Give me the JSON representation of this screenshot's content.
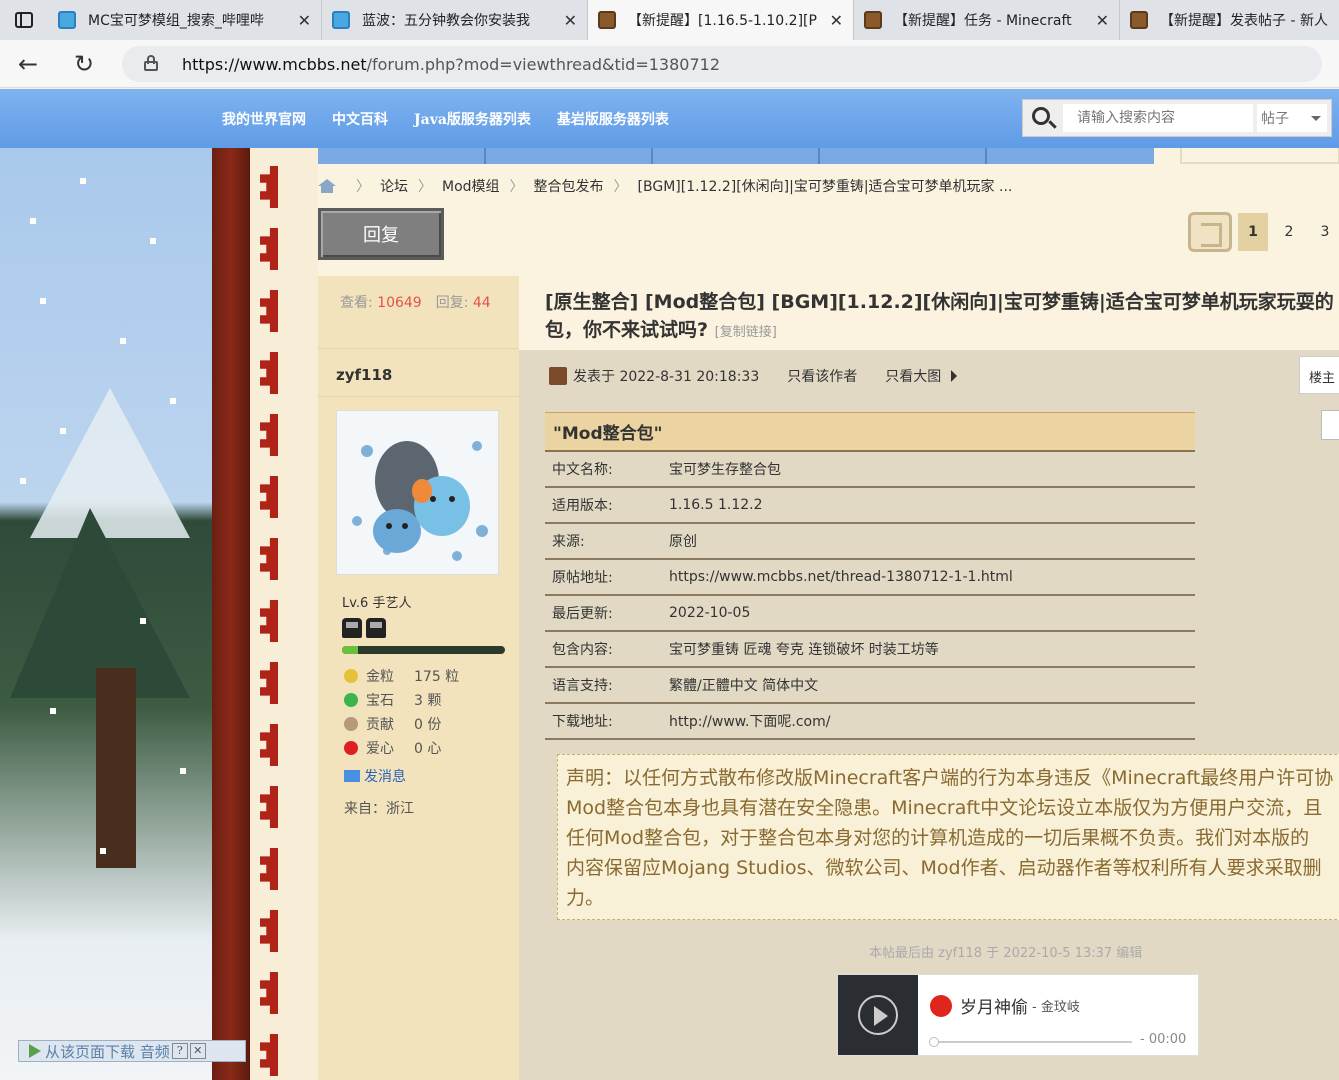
{
  "browser": {
    "tabs": [
      {
        "title": "MC宝可梦模组_搜索_哔哩哔",
        "icon": "bilibili-icon"
      },
      {
        "title": "蓝波：五分钟教会你安装我",
        "icon": "bilibili-icon"
      },
      {
        "title": "【新提醒】[1.16.5-1.10.2][P",
        "icon": "minecraft-chest-icon"
      },
      {
        "title": "【新提醒】任务 - Minecraft",
        "icon": "minecraft-chest-icon"
      },
      {
        "title": "【新提醒】发表帖子 - 新人",
        "icon": "minecraft-chest-icon"
      }
    ],
    "url_host": "https://www.mcbbs.net",
    "url_path": "/forum.php?mod=viewthread&tid=1380712"
  },
  "site_nav": {
    "links": [
      "我的世界官网",
      "中文百科",
      "Java版服务器列表",
      "基岩版服务器列表"
    ],
    "search_placeholder": "请输入搜索内容",
    "search_scope": "帖子"
  },
  "breadcrumb": [
    "论坛",
    "Mod模组",
    "整合包发布",
    "[BGM][1.12.2][休闲向]|宝可梦重铸|适合宝可梦单机玩家 ..."
  ],
  "reply_label": "回复",
  "pager": [
    "1",
    "2",
    "3"
  ],
  "thread": {
    "views_label": "查看:",
    "views": "10649",
    "replies_label": "回复:",
    "replies": "44",
    "title": "[原生整合] [Mod整合包] [BGM][1.12.2][休闲向]|宝可梦重铸|适合宝可梦单机玩家玩耍的",
    "title_line2": "包，你不来试试吗?",
    "copy_link": "[复制链接]"
  },
  "author": {
    "name": "zyf118",
    "level": "Lv.6 手艺人",
    "xp_fraction": 0.1,
    "credits": [
      {
        "label": "金粒",
        "value": "175 粒",
        "color": "#e6c23a"
      },
      {
        "label": "宝石",
        "value": "3 颗",
        "color": "#39b54a"
      },
      {
        "label": "贡献",
        "value": "0 份",
        "color": "#b59a7a"
      },
      {
        "label": "爱心",
        "value": "0 心",
        "color": "#e02020"
      }
    ],
    "send_message": "发消息",
    "from": "来自：浙江"
  },
  "post": {
    "posted_at": "发表于 2022-8-31 20:18:33",
    "only_author": "只看该作者",
    "only_big_images": "只看大图",
    "floor": "楼主",
    "table_title": "\"Mod整合包\"",
    "table_rows": [
      {
        "k": "中文名称:",
        "v": "宝可梦生存整合包"
      },
      {
        "k": "适用版本:",
        "v": "1.16.5 1.12.2"
      },
      {
        "k": "来源:",
        "v": "原创"
      },
      {
        "k": "原帖地址:",
        "v": "https://www.mcbbs.net/thread-1380712-1-1.html"
      },
      {
        "k": "最后更新:",
        "v": "2022-10-05"
      },
      {
        "k": "包含内容:",
        "v": "宝可梦重铸 匠魂 夸克 连锁破坏 时装工坊等"
      },
      {
        "k": "语言支持:",
        "v": "繁體/正體中文 简体中文"
      },
      {
        "k": "下载地址:",
        "v": "http://www.下面呢.com/"
      }
    ],
    "notice_lines": [
      "声明：以任何方式散布修改版Minecraft客户端的行为本身违反《Minecraft最终用户许可协",
      "Mod整合包本身也具有潜在安全隐患。Minecraft中文论坛设立本版仅为方便用户交流，且",
      "任何Mod整合包，对于整合包本身对您的计算机造成的一切后果概不负责。我们对本版的",
      "内容保留应Mojang Studios、微软公司、Mod作者、启动器作者等权利所有人要求采取删",
      "力。"
    ],
    "edit_note": "本帖最后由 zyf118 于 2022-10-5 13:37 编辑"
  },
  "player": {
    "song": "岁月神偷",
    "artist": "- 金玟岐",
    "time": "- 00:00"
  },
  "download_bar": "从该页面下载 音频"
}
